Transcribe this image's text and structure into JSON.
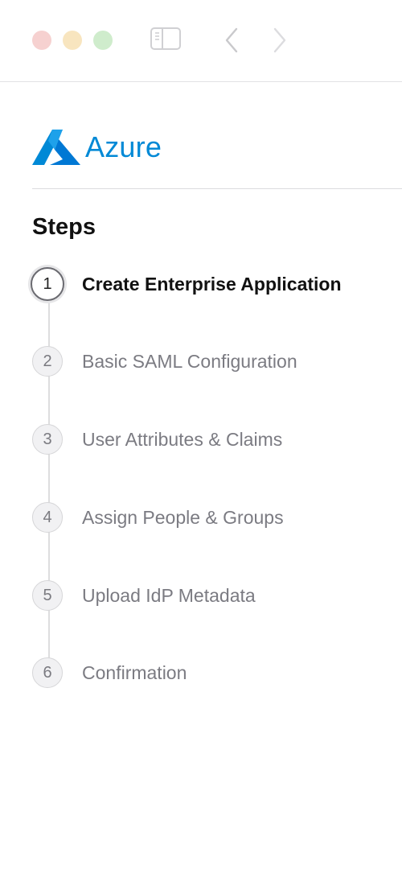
{
  "window": {
    "controls": [
      "close",
      "minimize",
      "maximize"
    ]
  },
  "toolbar": {
    "icons": [
      "sidebar-icon",
      "back-icon",
      "forward-icon"
    ]
  },
  "brand": {
    "name": "Azure",
    "color": "#0089d6"
  },
  "steps": {
    "title": "Steps",
    "active_index": 0,
    "items": [
      {
        "number": "1",
        "label": "Create Enterprise Application"
      },
      {
        "number": "2",
        "label": "Basic SAML Configuration"
      },
      {
        "number": "3",
        "label": "User Attributes & Claims"
      },
      {
        "number": "4",
        "label": "Assign People & Groups"
      },
      {
        "number": "5",
        "label": "Upload IdP Metadata"
      },
      {
        "number": "6",
        "label": "Confirmation"
      }
    ]
  }
}
